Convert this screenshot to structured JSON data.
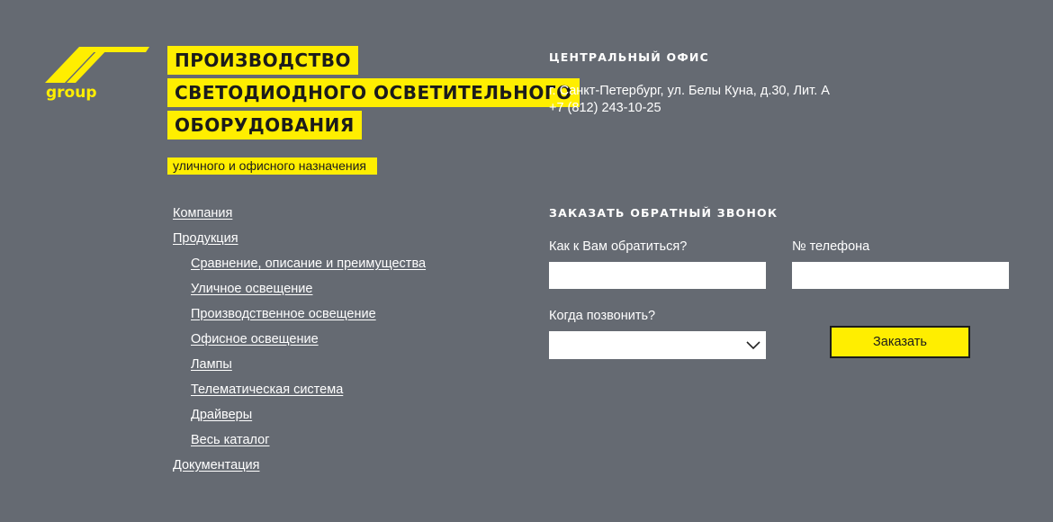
{
  "brand": {
    "logo_text": "group",
    "headline_lines": [
      "ПРОИЗВОДСТВО",
      "СВЕТОДИОДНОГО ОСВЕТИТЕЛЬНОГО",
      "ОБОРУДОВАНИЯ"
    ],
    "tagline": "уличного и офисного назначения",
    "accent_color": "#ffee00",
    "background_color": "#656a72"
  },
  "nav": {
    "items": [
      {
        "label": "Компания",
        "level": 0
      },
      {
        "label": "Продукция",
        "level": 0
      },
      {
        "label": "Сравнение, описание и преимущества",
        "level": 1
      },
      {
        "label": "Уличное освещение",
        "level": 1
      },
      {
        "label": "Производственное освещение",
        "level": 1
      },
      {
        "label": "Офисное освещение",
        "level": 1
      },
      {
        "label": "Лампы",
        "level": 1
      },
      {
        "label": "Телематическая система",
        "level": 1
      },
      {
        "label": "Драйверы",
        "level": 1
      },
      {
        "label": "Весь каталог",
        "level": 1
      },
      {
        "label": "Документация",
        "level": 0
      }
    ]
  },
  "office": {
    "title": "ЦЕНТРАЛЬНЫЙ ОФИС",
    "address": "г. Санкт-Петербург, ул. Белы Куна, д.30, Лит. А",
    "phone": "+7 (812) 243-10-25"
  },
  "callback": {
    "title": "ЗАКАЗАТЬ ОБРАТНЫЙ ЗВОНОК",
    "name_label": "Как к Вам обратиться?",
    "name_value": "",
    "phone_label": "№ телефона",
    "phone_value": "",
    "time_label": "Когда позвонить?",
    "time_selected": "",
    "submit_label": "Заказать"
  }
}
